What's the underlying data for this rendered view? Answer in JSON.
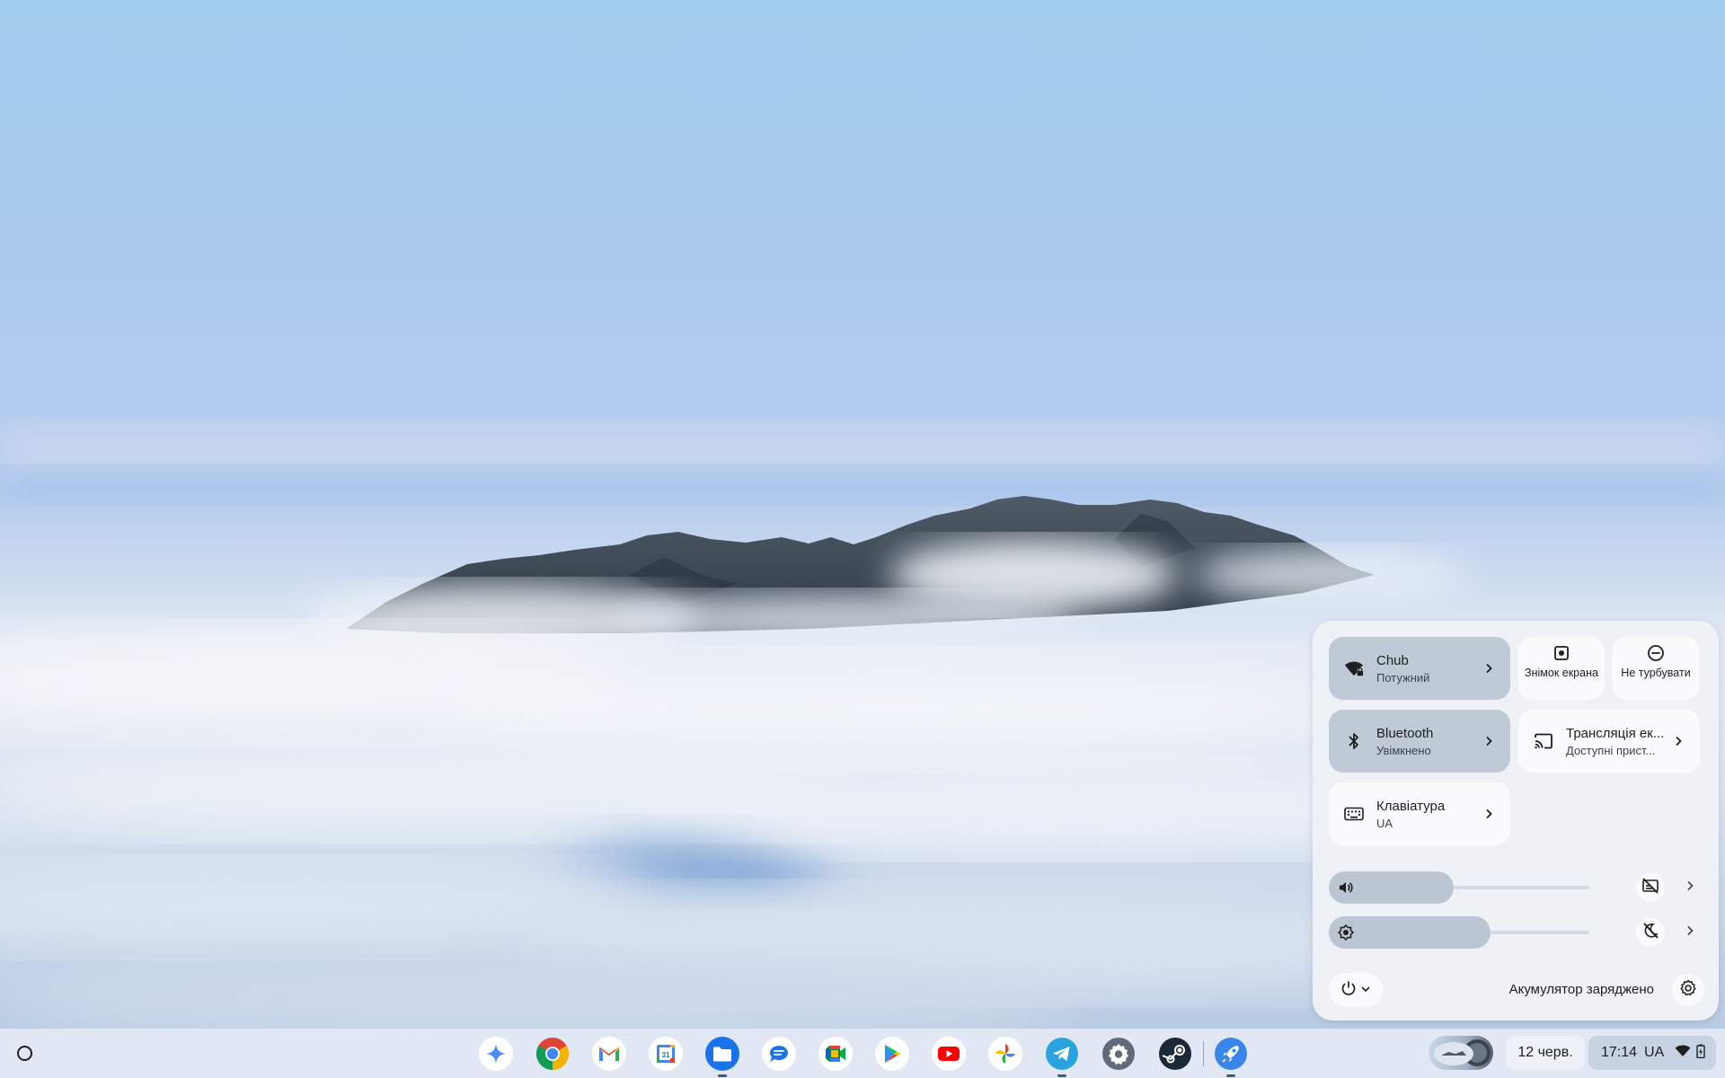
{
  "wallpaper": {
    "description_icon": "mountain-above-clouds"
  },
  "quick_settings": {
    "network": {
      "name": "Chub",
      "status": "Потужний",
      "icon": "wifi-lock-icon"
    },
    "screenshot": {
      "label": "Знімок екрана",
      "icon": "screen-capture-icon"
    },
    "dnd": {
      "label": "Не турбувати",
      "icon": "do-not-disturb-icon"
    },
    "bluetooth": {
      "name": "Bluetooth",
      "status": "Увімкнено",
      "icon": "bluetooth-icon"
    },
    "cast": {
      "name": "Трансляція ек...",
      "status": "Доступні прист...",
      "icon": "cast-icon"
    },
    "keyboard": {
      "name": "Клавіатура",
      "status": "UA",
      "icon": "keyboard-icon"
    },
    "volume": {
      "level": 0.48,
      "icon": "volume-icon",
      "side_icon": "captions-off-icon"
    },
    "brightness": {
      "level": 0.62,
      "icon": "brightness-icon",
      "side_icon": "night-light-off-icon"
    },
    "battery_status": "Акумулятор заряджено"
  },
  "shelf": {
    "apps": [
      {
        "name": "gemini",
        "running": false
      },
      {
        "name": "chrome",
        "running": false
      },
      {
        "name": "gmail",
        "running": false
      },
      {
        "name": "calendar",
        "running": false,
        "label": "31"
      },
      {
        "name": "files",
        "running": true
      },
      {
        "name": "messages",
        "running": false
      },
      {
        "name": "meet",
        "running": false
      },
      {
        "name": "play-store",
        "running": false
      },
      {
        "name": "youtube",
        "running": false
      },
      {
        "name": "photos",
        "running": false
      },
      {
        "name": "telegram",
        "running": true
      },
      {
        "name": "settings",
        "running": false
      },
      {
        "name": "steam",
        "running": false
      },
      {
        "name": "rocket-app",
        "running": true
      }
    ],
    "date": "12 черв.",
    "time": "17:14",
    "input_method": "UA"
  },
  "colors": {
    "tile_on": "#c0c9d6",
    "tile_off": "#fafbfd",
    "panel": "#eef1f6",
    "text": "#1f1f1f"
  }
}
